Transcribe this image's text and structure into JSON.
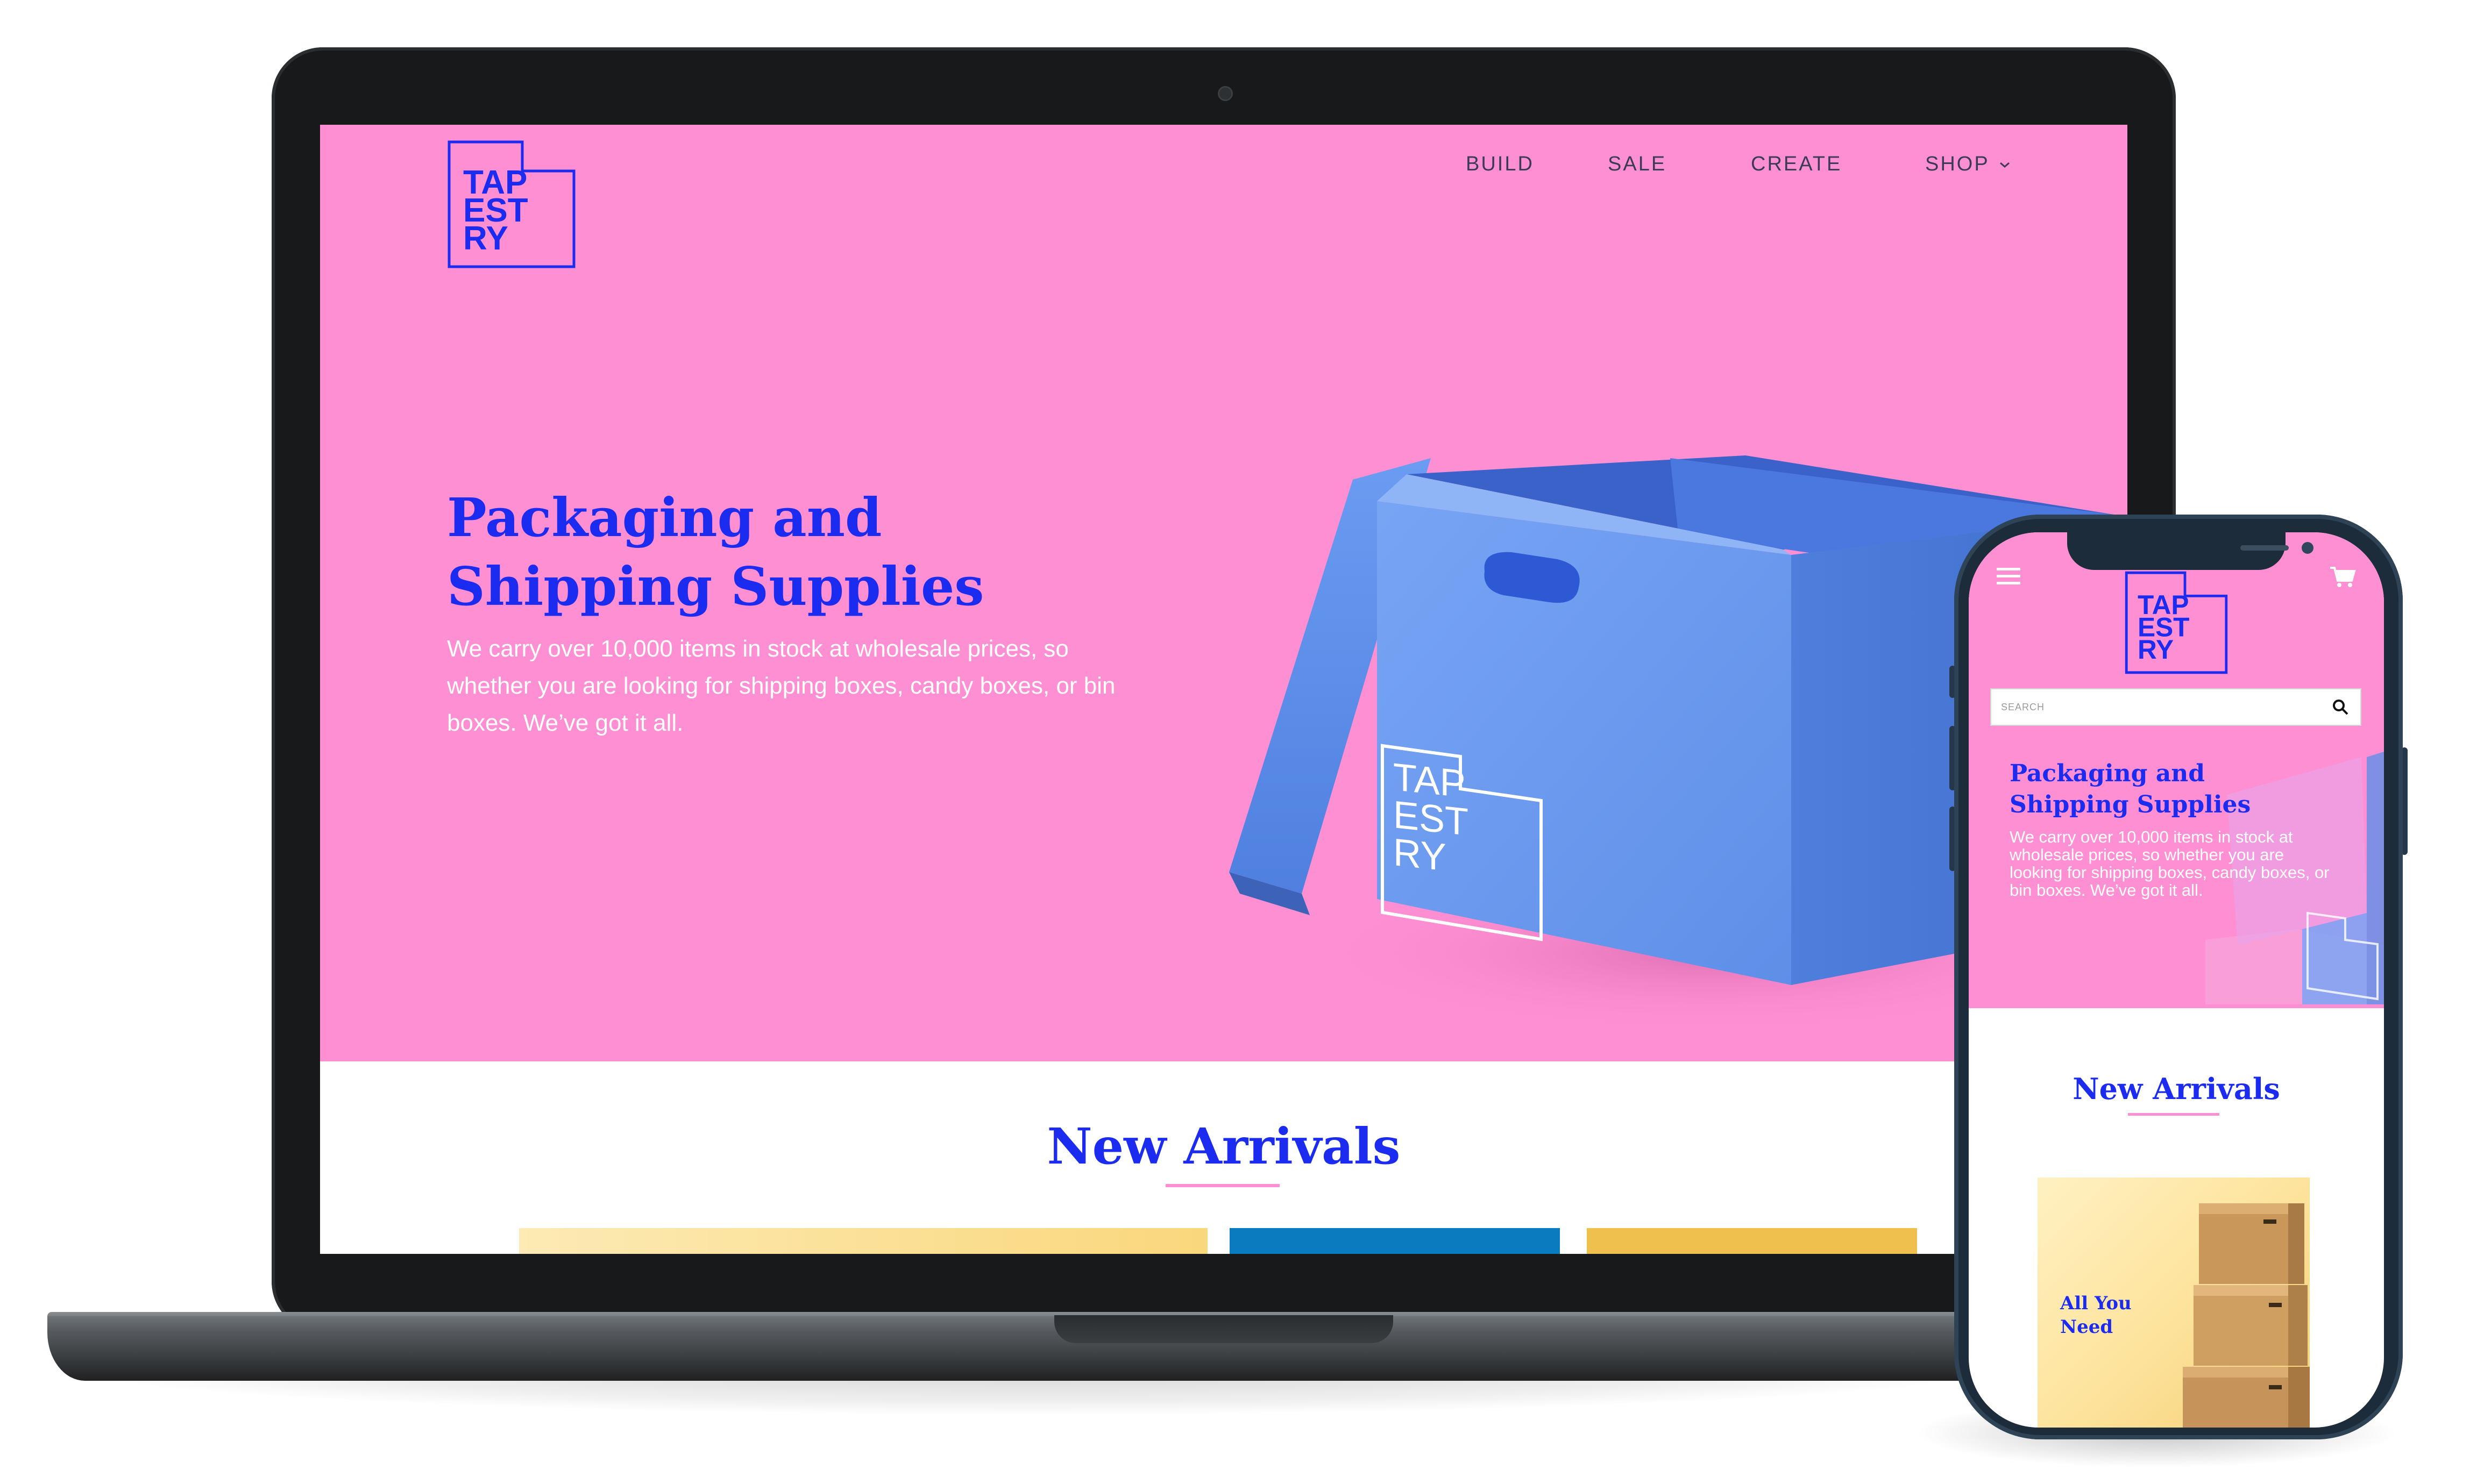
{
  "brand": {
    "logo_lines": [
      "TAP",
      "EST",
      "RY"
    ],
    "primary_color": "#1b2cf0",
    "hero_color": "#ff8fd3",
    "box_color": "#6a9bf2"
  },
  "nav": {
    "items": [
      {
        "label": "BUILD"
      },
      {
        "label": "SALE"
      },
      {
        "label": "CREATE"
      },
      {
        "label": "SHOP"
      }
    ],
    "shop_dropdown_icon": "chevron-down-icon"
  },
  "hero": {
    "title_line1": "Packaging and",
    "title_line2": "Shipping Supplies",
    "body": "We carry over 10,000 items in stock at wholesale prices, so whether you are looking for shipping boxes, candy boxes, or bin boxes. We’ve got it all."
  },
  "new_arrivals": {
    "title": "New Arrivals",
    "tile_colors": [
      "#fde6a6",
      "#0a7bbf",
      "#f0c04e"
    ]
  },
  "mobile": {
    "menu_icon": "hamburger-menu-icon",
    "cart_icon": "shopping-cart-icon",
    "search": {
      "placeholder": "SEARCH",
      "value": ""
    },
    "hero": {
      "title": "Packaging and Shipping Supplies",
      "body": "We carry over 10,000 items in stock at wholesale prices, so whether you are looking for shipping boxes, candy boxes, or bin boxes. We’ve got it all."
    },
    "new_arrivals_title": "New Arrivals",
    "product_card": {
      "label_line1": "All You",
      "label_line2": "Need"
    }
  }
}
